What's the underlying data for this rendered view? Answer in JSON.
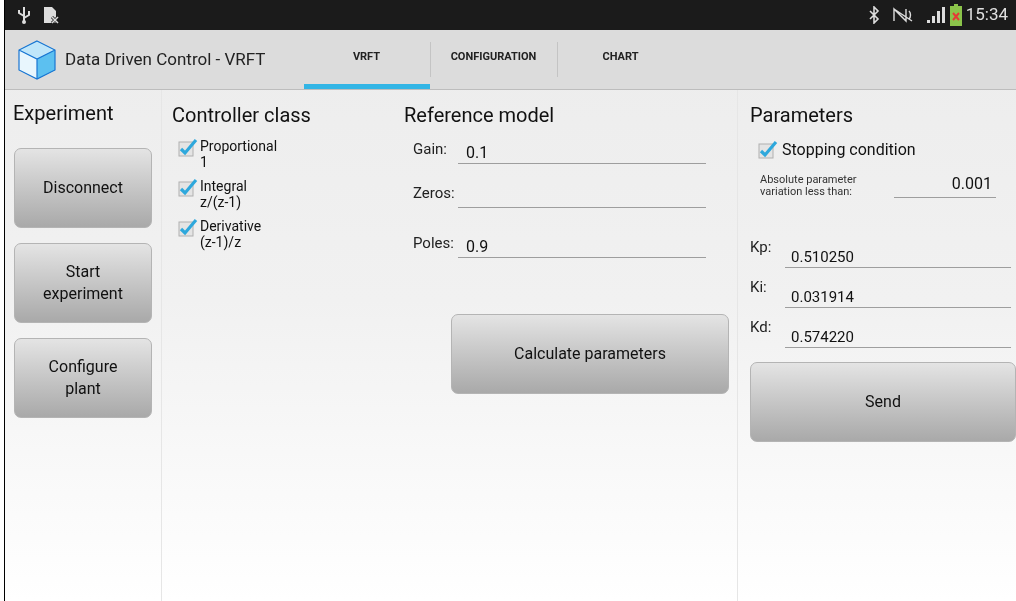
{
  "status_bar": {
    "time": "15:34"
  },
  "action_bar": {
    "title": "Data Driven Control - VRFT",
    "tabs": [
      {
        "label": "VRFT",
        "selected": true
      },
      {
        "label": "CONFIGURATION",
        "selected": false
      },
      {
        "label": "CHART",
        "selected": false
      }
    ]
  },
  "experiment": {
    "heading": "Experiment",
    "buttons": [
      "Disconnect",
      "Start\nexperiment",
      "Configure\nplant"
    ]
  },
  "controller_class": {
    "heading": "Controller class",
    "options": [
      {
        "label": "Proportional",
        "formula": "1",
        "checked": true
      },
      {
        "label": "Integral",
        "formula": "z/(z-1)",
        "checked": true
      },
      {
        "label": "Derivative",
        "formula": "(z-1)/z",
        "checked": true
      }
    ]
  },
  "reference_model": {
    "heading": "Reference model",
    "fields": [
      {
        "label": "Gain:",
        "value": "0.1"
      },
      {
        "label": "Zeros:"
      },
      {
        "label": "Poles:",
        "value": "0.9"
      }
    ],
    "button": "Calculate parameters"
  },
  "parameters": {
    "heading": "Parameters",
    "stopping_condition": {
      "label": "Stopping condition",
      "checked": true
    },
    "threshold": {
      "label": "Absolute parameter\nvariation less than:",
      "value": "0.001"
    },
    "fields": [
      {
        "label": "Kp:",
        "value": "0.510250"
      },
      {
        "label": "Ki:",
        "value": "0.031914"
      },
      {
        "label": "Kd:",
        "value": "0.574220"
      }
    ],
    "button": "Send"
  }
}
